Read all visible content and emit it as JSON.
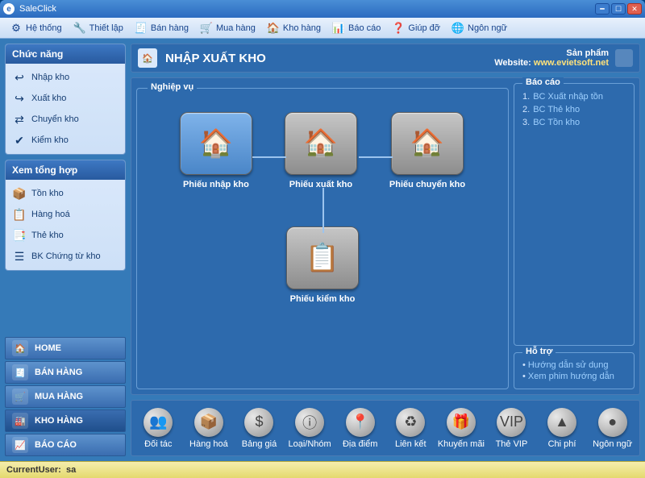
{
  "window": {
    "title": "SaleClick",
    "app_icon_letter": "e"
  },
  "menubar": [
    {
      "label": "Hệ thống",
      "icon": "⚙"
    },
    {
      "label": "Thiết lập",
      "icon": "🔧"
    },
    {
      "label": "Bán hàng",
      "icon": "🧾"
    },
    {
      "label": "Mua hàng",
      "icon": "🛒"
    },
    {
      "label": "Kho hàng",
      "icon": "🏠"
    },
    {
      "label": "Báo cáo",
      "icon": "📊"
    },
    {
      "label": "Giúp đỡ",
      "icon": "❓"
    },
    {
      "label": "Ngôn ngữ",
      "icon": "🌐"
    }
  ],
  "sidebar": {
    "panel1": {
      "title": "Chức năng",
      "items": [
        {
          "label": "Nhập kho",
          "icon": "↩"
        },
        {
          "label": "Xuất kho",
          "icon": "↪"
        },
        {
          "label": "Chuyển kho",
          "icon": "⇄"
        },
        {
          "label": "Kiểm kho",
          "icon": "✔"
        }
      ]
    },
    "panel2": {
      "title": "Xem tổng hợp",
      "items": [
        {
          "label": "Tồn kho",
          "icon": "📦"
        },
        {
          "label": "Hàng hoá",
          "icon": "📋"
        },
        {
          "label": "Thẻ kho",
          "icon": "📑"
        },
        {
          "label": "BK Chứng từ kho",
          "icon": "☰"
        }
      ]
    },
    "nav": [
      {
        "label": "HOME",
        "icon": "🏠"
      },
      {
        "label": "BÁN HÀNG",
        "icon": "🧾"
      },
      {
        "label": "MUA HÀNG",
        "icon": "🛒"
      },
      {
        "label": "KHO HÀNG",
        "icon": "🏭"
      },
      {
        "label": "BÁO CÁO",
        "icon": "📈"
      }
    ],
    "nav_active_index": 3
  },
  "header": {
    "title": "NHẬP XUẤT KHO",
    "product": "Sản phẩm",
    "website_label": "Website:",
    "website_url": "www.evietsoft.net"
  },
  "workspace": {
    "fieldset_label": "Nghiệp vụ",
    "cards": {
      "row": [
        {
          "label": "Phiếu nhập kho",
          "active": true
        },
        {
          "label": "Phiếu xuất kho",
          "active": false
        },
        {
          "label": "Phiếu chuyển kho",
          "active": false
        }
      ],
      "bottom": {
        "label": "Phiếu kiểm kho",
        "active": false
      }
    },
    "reports": {
      "title": "Báo cáo",
      "items": [
        "BC Xuất nhập tồn",
        "BC Thẻ kho",
        "BC Tồn kho"
      ]
    },
    "support": {
      "title": "Hỗ trợ",
      "items": [
        "Hướng dẫn sử dụng",
        "Xem phim hướng dẫn"
      ]
    }
  },
  "bottombar": [
    {
      "label": "Đối tác",
      "icon": "👥"
    },
    {
      "label": "Hàng hoá",
      "icon": "📦"
    },
    {
      "label": "Bảng giá",
      "icon": "$"
    },
    {
      "label": "Loại/Nhóm",
      "icon": "ⓘ"
    },
    {
      "label": "Địa điểm",
      "icon": "📍"
    },
    {
      "label": "Liên kết",
      "icon": "♻"
    },
    {
      "label": "Khuyến mãi",
      "icon": "🎁"
    },
    {
      "label": "Thẻ VIP",
      "icon": "VIP"
    },
    {
      "label": "Chi phí",
      "icon": "▲"
    },
    {
      "label": "Ngôn ngữ",
      "icon": "●"
    }
  ],
  "statusbar": {
    "user_label": "CurrentUser:",
    "user": "sa"
  }
}
